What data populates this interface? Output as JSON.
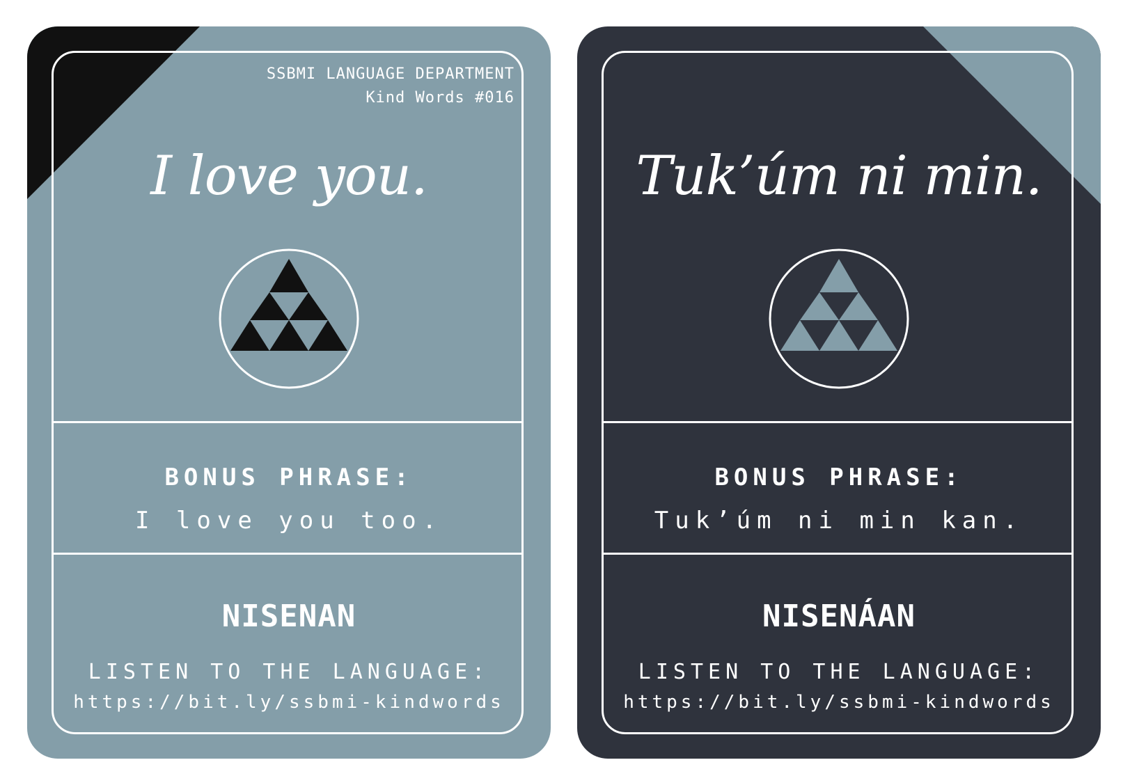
{
  "colors": {
    "card_light_bg": "#849ea9",
    "card_dark_bg": "#2f333d",
    "corner_dark": "#111111",
    "corner_light": "#849ea9",
    "text": "#ffffff"
  },
  "left_card": {
    "department": "SSBMI LANGUAGE DEPARTMENT",
    "series": "Kind Words #016",
    "phrase": "I love you.",
    "emblem_icon": "triangle-pyramid-icon",
    "bonus_title": "BONUS PHRASE:",
    "bonus_text": "I love you too.",
    "language": "NISENAN",
    "listen_label": "LISTEN TO THE LANGUAGE:",
    "url": "https://bit.ly/ssbmi-kindwords"
  },
  "right_card": {
    "phrase": "Tuk’úm ni min.",
    "emblem_icon": "triangle-pyramid-icon",
    "bonus_title": "BONUS PHRASE:",
    "bonus_text": "Tuk’úm ni min kan.",
    "language": "NISENÁAN",
    "listen_label": "LISTEN TO THE LANGUAGE:",
    "url": "https://bit.ly/ssbmi-kindwords"
  }
}
